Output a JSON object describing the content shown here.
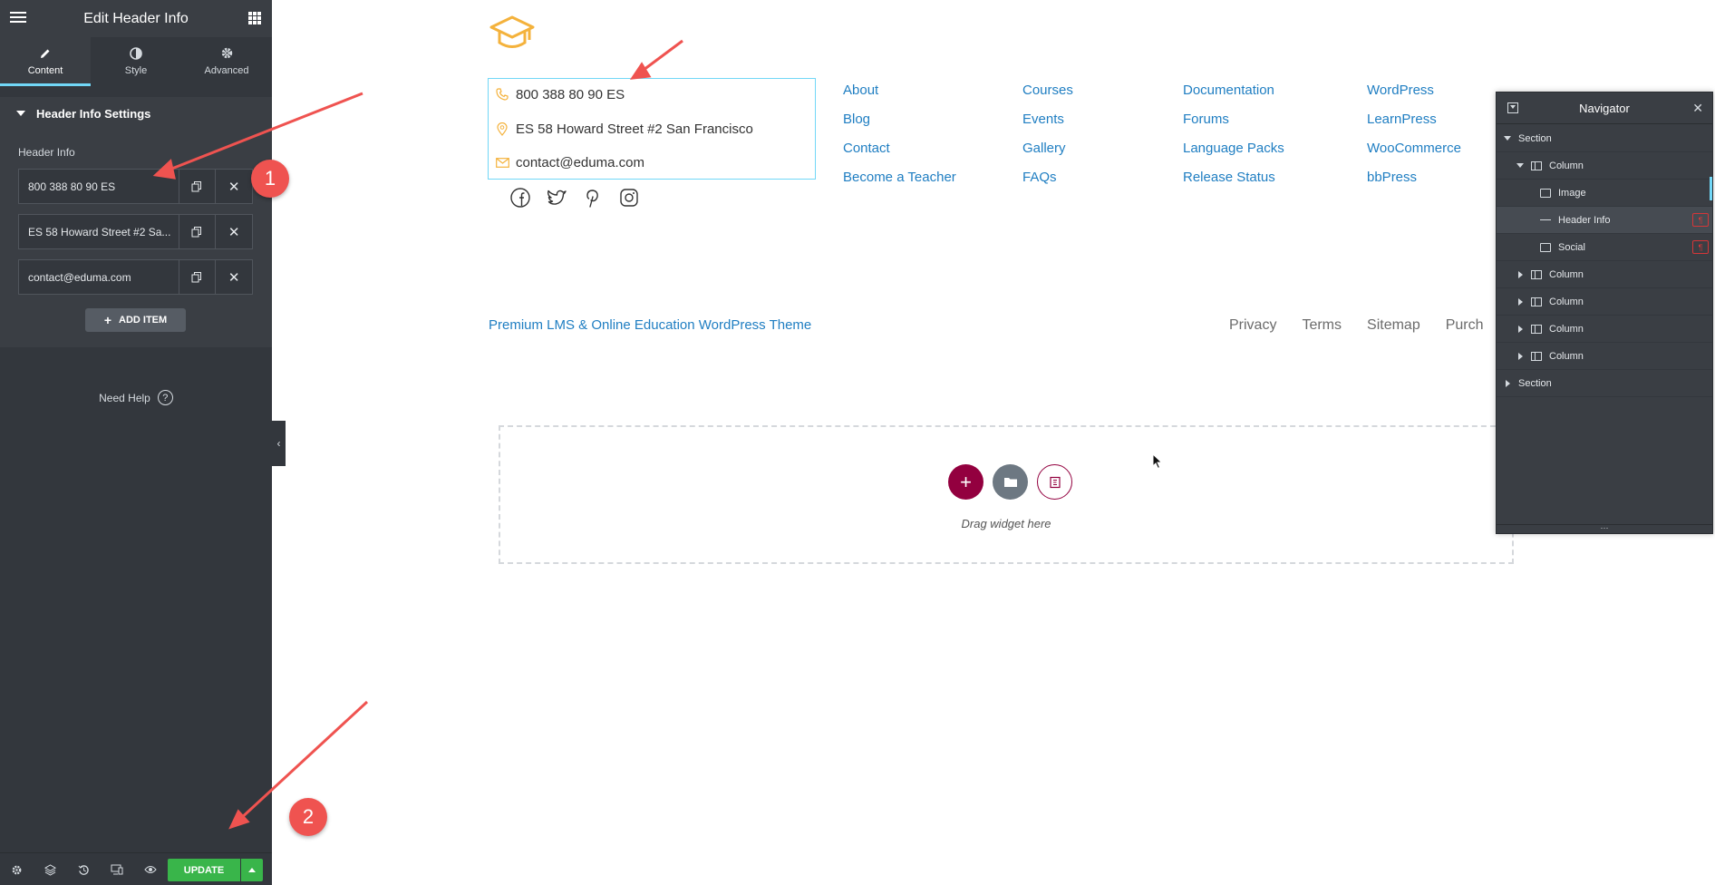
{
  "editor": {
    "title": "Edit Header Info",
    "tabs": [
      {
        "label": "Content",
        "icon": "pencil-icon"
      },
      {
        "label": "Style",
        "icon": "contrast-icon"
      },
      {
        "label": "Advanced",
        "icon": "gear-icon"
      }
    ],
    "section_title": "Header Info Settings",
    "field_label": "Header Info",
    "items": [
      {
        "text": "800 388 80 90 ES"
      },
      {
        "text": "ES 58 Howard Street #2 Sa..."
      },
      {
        "text": "contact@eduma.com"
      }
    ],
    "add_item_label": "ADD ITEM",
    "help_label": "Need Help",
    "update_label": "UPDATE"
  },
  "page": {
    "contacts": [
      {
        "icon": "phone-icon",
        "text": "800 388 80 90 ES"
      },
      {
        "icon": "location-pin-icon",
        "text": "ES 58 Howard Street #2 San Francisco"
      },
      {
        "icon": "envelope-icon",
        "text": "contact@eduma.com"
      }
    ],
    "social": [
      "facebook-icon",
      "twitter-icon",
      "pinterest-icon",
      "instagram-icon"
    ],
    "link_columns": [
      [
        "About",
        "Blog",
        "Contact",
        "Become a Teacher"
      ],
      [
        "Courses",
        "Events",
        "Gallery",
        "FAQs"
      ],
      [
        "Documentation",
        "Forums",
        "Language Packs",
        "Release Status"
      ],
      [
        "WordPress",
        "LearnPress",
        "WooCommerce",
        "bbPress"
      ]
    ],
    "tagline": "Premium LMS & Online Education WordPress Theme",
    "bottom_links": [
      "Privacy",
      "Terms",
      "Sitemap",
      "Purch"
    ],
    "dropzone_text": "Drag widget here"
  },
  "navigator": {
    "title": "Navigator",
    "rows": [
      {
        "label": "Section"
      },
      {
        "label": "Column"
      },
      {
        "label": "Image"
      },
      {
        "label": "Header Info"
      },
      {
        "label": "Social"
      },
      {
        "label": "Column"
      },
      {
        "label": "Column"
      },
      {
        "label": "Column"
      },
      {
        "label": "Column"
      },
      {
        "label": "Section"
      }
    ]
  },
  "annotations": [
    {
      "label": "1"
    },
    {
      "label": "2"
    }
  ],
  "colors": {
    "panel": "#33373d",
    "accent": "#71d7f7",
    "link": "#1f7ec2",
    "update": "#39b54a",
    "brand": "#93003f",
    "annotation": "#ef5350",
    "logo": "#f4b23c"
  }
}
